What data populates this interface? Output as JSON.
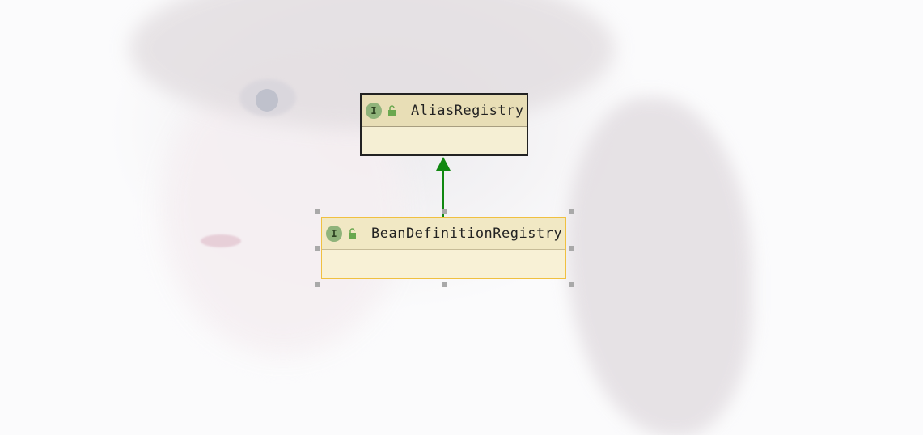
{
  "diagram": {
    "parent_class": {
      "name": "AliasRegistry",
      "kind_icon": "interface-icon",
      "kind_letter": "I",
      "visibility_icon": "public-lock-icon"
    },
    "child_class": {
      "name": "BeanDefinitionRegistry",
      "kind_icon": "interface-icon",
      "kind_letter": "I",
      "visibility_icon": "public-lock-icon",
      "selected": true
    },
    "relationship": {
      "type": "extends",
      "color": "#118811"
    }
  },
  "colors": {
    "box_fill": "#f5efd4",
    "header_fill": "#e8deb6",
    "selection_border": "#f0c040",
    "interface_badge": "#8fb37a"
  }
}
